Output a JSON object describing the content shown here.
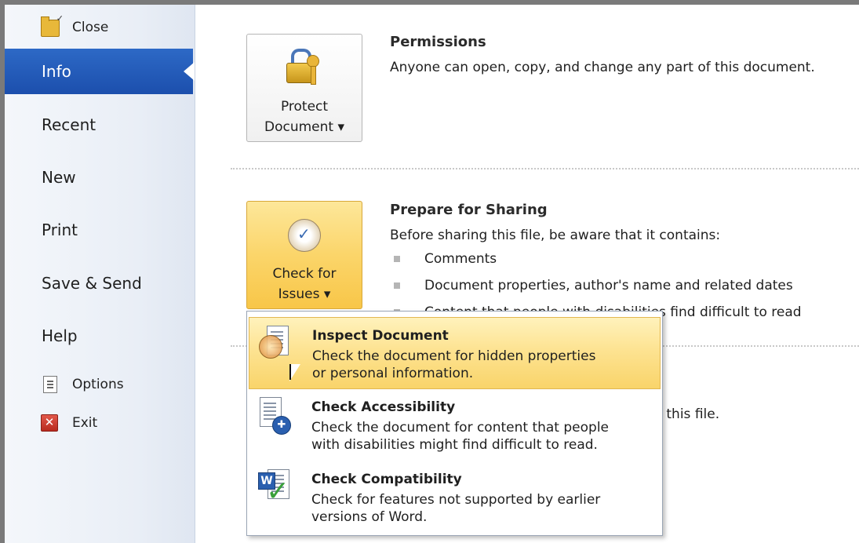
{
  "sidebar": {
    "close_label": "Close",
    "items": [
      {
        "label": "Info",
        "active": true
      },
      {
        "label": "Recent"
      },
      {
        "label": "New"
      },
      {
        "label": "Print"
      },
      {
        "label": "Save & Send"
      },
      {
        "label": "Help"
      }
    ],
    "options_label": "Options",
    "exit_label": "Exit"
  },
  "permissions": {
    "button_line1": "Protect",
    "button_line2": "Document ▾",
    "title": "Permissions",
    "text": "Anyone can open, copy, and change any part of this document."
  },
  "prepare": {
    "button_line1": "Check for",
    "button_line2": "Issues ▾",
    "title": "Prepare for Sharing",
    "text": "Before sharing this file, be aware that it contains:",
    "bullets": [
      "Comments",
      "Document properties, author's name and related dates",
      "Content that people with disabilities find difficult to read"
    ]
  },
  "versions_fragment": "f this file.",
  "dropdown": {
    "items": [
      {
        "title": "Inspect Document",
        "desc1": "Check the document for hidden properties",
        "desc2": "or personal information."
      },
      {
        "title": "Check Accessibility",
        "desc1": "Check the document for content that people",
        "desc2": "with disabilities might find difficult to read."
      },
      {
        "title": "Check Compatibility",
        "desc1": "Check for features not supported by earlier",
        "desc2": "versions of Word."
      }
    ]
  },
  "colors": {
    "active_nav": "#2d69c6",
    "highlight": "#fbd56a"
  }
}
